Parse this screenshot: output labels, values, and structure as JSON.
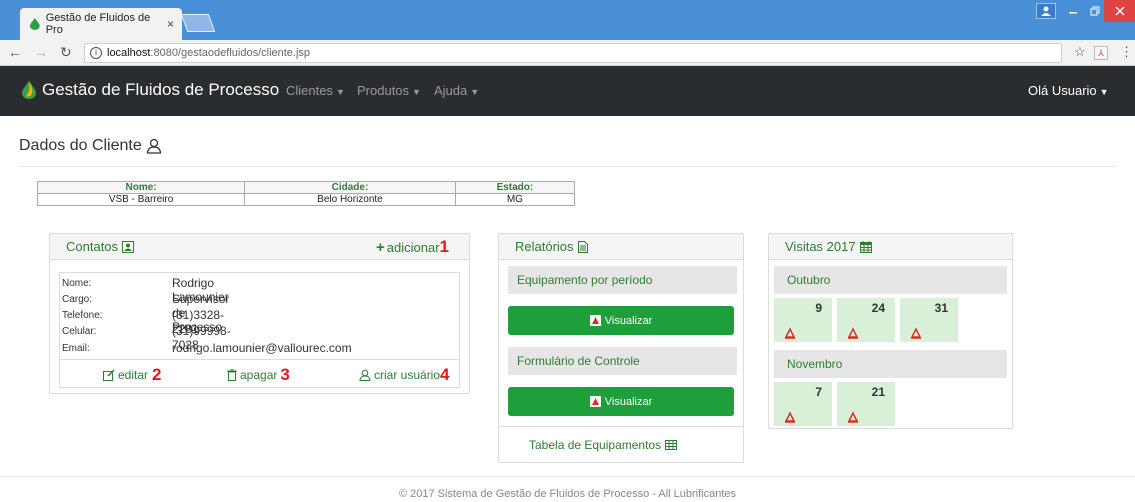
{
  "browser": {
    "tab_title": "Gestão de Fluidos de Pro",
    "tab_close": "×",
    "url_host": "localhost",
    "url_path": ":8080/gestaodefluidos/cliente.jsp"
  },
  "navbar": {
    "brand": "Gestão de Fluidos de Processo",
    "menus": [
      "Clientes",
      "Produtos",
      "Ajuda"
    ],
    "user": "Olá Usuario"
  },
  "page": {
    "title": "Dados do Cliente"
  },
  "client": {
    "headers": [
      "Nome:",
      "Cidade:",
      "Estado:"
    ],
    "values": [
      "VSB - Barreiro",
      "Belo Horizonte",
      "MG"
    ]
  },
  "contatos": {
    "title": "Contatos",
    "add_label": "adicionar",
    "fields": [
      {
        "label": "Nome:",
        "value": "Rodrigo Lamounier"
      },
      {
        "label": "Cargo:",
        "value": "Supervisor de Processo"
      },
      {
        "label": "Telefone:",
        "value": "(31)3328-2281"
      },
      {
        "label": "Celular:",
        "value": "(31)99998-7028"
      },
      {
        "label": "Email:",
        "value": "rodrigo.lamounier@vallourec.com"
      }
    ],
    "actions": {
      "edit": "editar",
      "delete": "apagar",
      "create_user": "criar usuário"
    }
  },
  "annotations": [
    "1",
    "2",
    "3",
    "4"
  ],
  "relatorios": {
    "title": "Relatórios",
    "sections": [
      {
        "title": "Equipamento por período",
        "button": "Visualizar"
      },
      {
        "title": "Formulário de Controle",
        "button": "Visualizar"
      }
    ],
    "table_link": "Tabela de Equipamentos"
  },
  "visitas": {
    "title": "Visitas 2017",
    "months": [
      {
        "name": "Outubro",
        "days": [
          "9",
          "24",
          "31"
        ]
      },
      {
        "name": "Novembro",
        "days": [
          "7",
          "21"
        ]
      }
    ]
  },
  "footer": "© 2017 Sistema de Gestão de Fluidos de Processo - All Lubrificantes",
  "colors": {
    "accent_green": "#2e7d32",
    "button_green": "#1f9e3c",
    "navbar": "#2a2d30",
    "badge_red": "#e01b1b"
  }
}
